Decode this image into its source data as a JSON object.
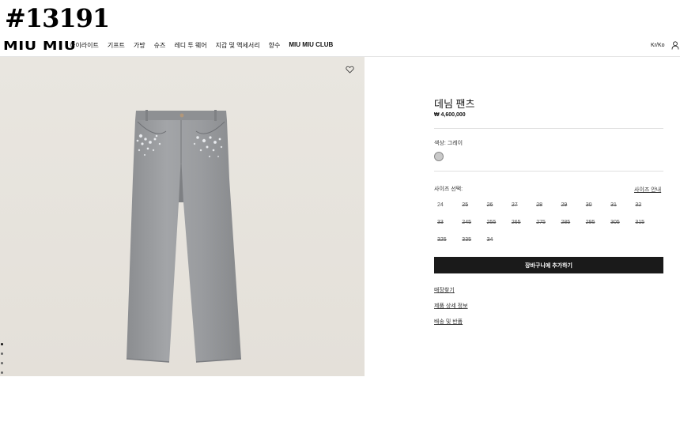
{
  "post_id": "#13191",
  "header": {
    "logo": "MIU MIU",
    "nav": [
      "하이라이트",
      "기프트",
      "가방",
      "슈즈",
      "레디 투 웨어",
      "지갑 및 액세서리",
      "향수",
      "MIU MIU CLUB"
    ],
    "lang": "Kr/Ko",
    "user_icon": "user-icon"
  },
  "gallery": {
    "wishlist_icon": "heart-icon",
    "dots": 5,
    "active_dot": 1
  },
  "product": {
    "title": "데님 팬츠",
    "price": "₩ 4,600,000",
    "color_label": "색상: 그레이",
    "swatch_color": "#c9c9c9",
    "size_label": "사이즈 선택:",
    "size_guide": "사이즈 안내",
    "sizes": [
      "24",
      "25",
      "26",
      "27",
      "28",
      "29",
      "30",
      "31",
      "32",
      "33",
      "245",
      "255",
      "265",
      "275",
      "285",
      "295",
      "305",
      "315",
      "325",
      "335",
      "34"
    ],
    "out_of_stock": [
      "25",
      "26",
      "27",
      "28",
      "29",
      "30",
      "31",
      "32",
      "33",
      "245",
      "255",
      "265",
      "275",
      "285",
      "295",
      "305",
      "315",
      "325",
      "335",
      "34"
    ],
    "add_to_cart": "장바구니에 추가하기",
    "links": [
      "매장찾기",
      "제품 상세 정보",
      "배송 및 반품"
    ]
  }
}
